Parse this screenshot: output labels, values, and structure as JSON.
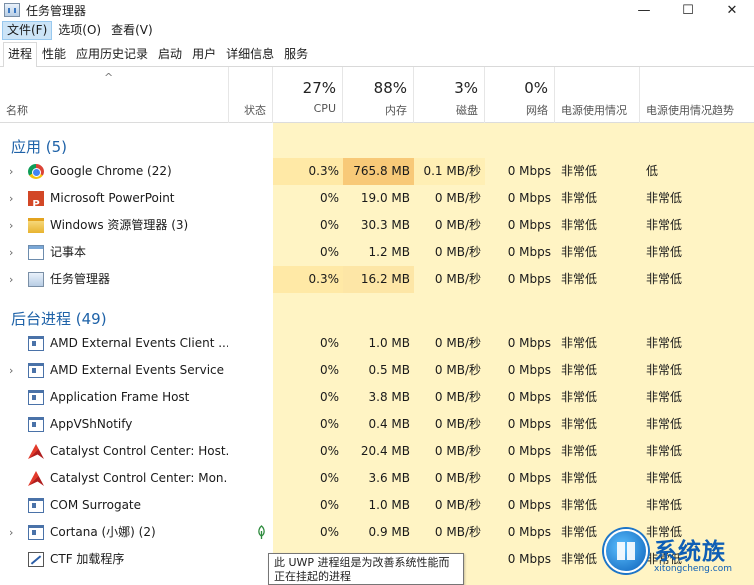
{
  "window": {
    "title": "任务管理器",
    "minimize": "—",
    "maximize": "☐",
    "close": "✕"
  },
  "menu": [
    "文件(F)",
    "选项(O)",
    "查看(V)"
  ],
  "tabs": [
    "进程",
    "性能",
    "应用历史记录",
    "启动",
    "用户",
    "详细信息",
    "服务"
  ],
  "columns": {
    "name": "名称",
    "status": "状态",
    "cpu": {
      "pct": "27%",
      "label": "CPU"
    },
    "memory": {
      "pct": "88%",
      "label": "内存"
    },
    "disk": {
      "pct": "3%",
      "label": "磁盘"
    },
    "network": {
      "pct": "0%",
      "label": "网络"
    },
    "power": "电源使用情况",
    "power_trend": "电源使用情况趋势",
    "sort_glyph": "^"
  },
  "groups": {
    "apps": "应用 (5)",
    "background": "后台进程 (49)"
  },
  "apps": [
    {
      "name": "Google Chrome (22)",
      "icon": "chrome-icon",
      "expand": "›",
      "cpu": "0.3%",
      "mem": "765.8 MB",
      "disk": "0.1 MB/秒",
      "net": "0 Mbps",
      "pwr": "非常低",
      "pwrt": "低"
    },
    {
      "name": "Microsoft PowerPoint",
      "icon": "powerpoint-icon",
      "expand": "›",
      "cpu": "0%",
      "mem": "19.0 MB",
      "disk": "0 MB/秒",
      "net": "0 Mbps",
      "pwr": "非常低",
      "pwrt": "非常低"
    },
    {
      "name": "Windows 资源管理器 (3)",
      "icon": "explorer-icon",
      "expand": "›",
      "cpu": "0%",
      "mem": "30.3 MB",
      "disk": "0 MB/秒",
      "net": "0 Mbps",
      "pwr": "非常低",
      "pwrt": "非常低"
    },
    {
      "name": "记事本",
      "icon": "notepad-icon",
      "expand": "›",
      "cpu": "0%",
      "mem": "1.2 MB",
      "disk": "0 MB/秒",
      "net": "0 Mbps",
      "pwr": "非常低",
      "pwrt": "非常低"
    },
    {
      "name": "任务管理器",
      "icon": "task-manager-icon",
      "expand": "›",
      "cpu": "0.3%",
      "mem": "16.2 MB",
      "disk": "0 MB/秒",
      "net": "0 Mbps",
      "pwr": "非常低",
      "pwrt": "非常低"
    }
  ],
  "background": [
    {
      "name": "AMD External Events Client ...",
      "icon": "app-window-icon",
      "expand": "",
      "cpu": "0%",
      "mem": "1.0 MB",
      "disk": "0 MB/秒",
      "net": "0 Mbps",
      "pwr": "非常低",
      "pwrt": "非常低"
    },
    {
      "name": "AMD External Events Service ...",
      "icon": "app-window-icon",
      "expand": "›",
      "cpu": "0%",
      "mem": "0.5 MB",
      "disk": "0 MB/秒",
      "net": "0 Mbps",
      "pwr": "非常低",
      "pwrt": "非常低"
    },
    {
      "name": "Application Frame Host",
      "icon": "app-window-icon",
      "expand": "",
      "cpu": "0%",
      "mem": "3.8 MB",
      "disk": "0 MB/秒",
      "net": "0 Mbps",
      "pwr": "非常低",
      "pwrt": "非常低"
    },
    {
      "name": "AppVShNotify",
      "icon": "app-window-icon",
      "expand": "",
      "cpu": "0%",
      "mem": "0.4 MB",
      "disk": "0 MB/秒",
      "net": "0 Mbps",
      "pwr": "非常低",
      "pwrt": "非常低"
    },
    {
      "name": "Catalyst Control Center: Host...",
      "icon": "catalyst-icon",
      "expand": "",
      "cpu": "0%",
      "mem": "20.4 MB",
      "disk": "0 MB/秒",
      "net": "0 Mbps",
      "pwr": "非常低",
      "pwrt": "非常低"
    },
    {
      "name": "Catalyst Control Center: Mon...",
      "icon": "catalyst-icon",
      "expand": "",
      "cpu": "0%",
      "mem": "3.6 MB",
      "disk": "0 MB/秒",
      "net": "0 Mbps",
      "pwr": "非常低",
      "pwrt": "非常低"
    },
    {
      "name": "COM Surrogate",
      "icon": "app-window-icon",
      "expand": "",
      "cpu": "0%",
      "mem": "1.0 MB",
      "disk": "0 MB/秒",
      "net": "0 Mbps",
      "pwr": "非常低",
      "pwrt": "非常低"
    },
    {
      "name": "Cortana (小娜) (2)",
      "icon": "app-window-icon",
      "expand": "›",
      "cpu": "0%",
      "mem": "0.9 MB",
      "disk": "0 MB/秒",
      "net": "0 Mbps",
      "pwr": "非常低",
      "pwrt": "非常低",
      "suspended": true
    },
    {
      "name": "CTF 加载程序",
      "icon": "ctf-icon",
      "expand": "",
      "cpu": "",
      "mem": "",
      "disk": "",
      "net": "0 Mbps",
      "pwr": "非常低",
      "pwrt": "非常低"
    }
  ],
  "tooltip": {
    "line1": "此 UWP 进程组是为改善系统性能而",
    "line2": "正在挂起的进程"
  },
  "watermark": {
    "brand": "系统族",
    "url": "xitongcheng.com"
  },
  "colors": {
    "heat_low": "#fff4c4",
    "heat_mem_high": "#f8c978",
    "group_label": "#1e62a8",
    "menu_active": "#cce4f7"
  }
}
